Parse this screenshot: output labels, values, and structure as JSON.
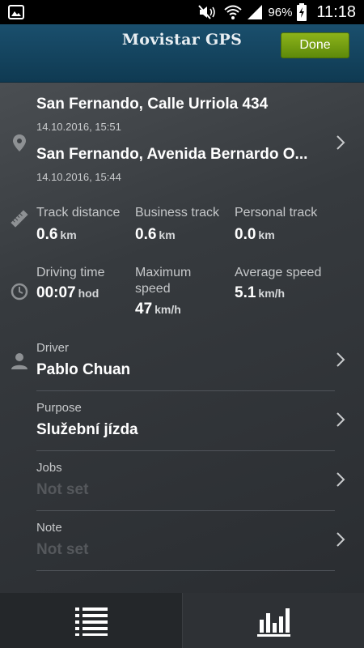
{
  "status_bar": {
    "battery_percent": "96%",
    "time": "11:18",
    "icons": [
      "image-icon",
      "mute-icon",
      "wifi-icon",
      "signal-icon",
      "battery-icon"
    ]
  },
  "header": {
    "title": "Movistar GPS",
    "done_label": "Done"
  },
  "route": {
    "destination": "San Fernando, Calle Urriola 434",
    "destination_time": "14.10.2016, 15:51",
    "origin": "San Fernando, Avenida Bernardo O...",
    "origin_time": "14.10.2016, 15:44"
  },
  "distances": {
    "track_distance_label": "Track distance",
    "track_distance_value": "0.6",
    "business_track_label": "Business track",
    "business_track_value": "0.6",
    "personal_track_label": "Personal track",
    "personal_track_value": "0.0",
    "unit": "km"
  },
  "times": {
    "driving_time_label": "Driving time",
    "driving_time_value": "00:07",
    "driving_time_unit": "hod",
    "max_speed_label_1": "Maximum",
    "max_speed_label_2": "speed",
    "max_speed_value": "47",
    "avg_speed_label": "Average speed",
    "avg_speed_value": "5.1",
    "speed_unit": "km/h"
  },
  "driver": {
    "label": "Driver",
    "value": "Pablo Chuan"
  },
  "purpose": {
    "label": "Purpose",
    "value": "Služební jízda"
  },
  "jobs": {
    "label": "Jobs",
    "value": "Not set"
  },
  "note": {
    "label": "Note",
    "value": "Not set"
  },
  "colors": {
    "header_bg": "#1a4f6d",
    "done_button": "#7aa213",
    "placeholder_text": "#55585c"
  }
}
